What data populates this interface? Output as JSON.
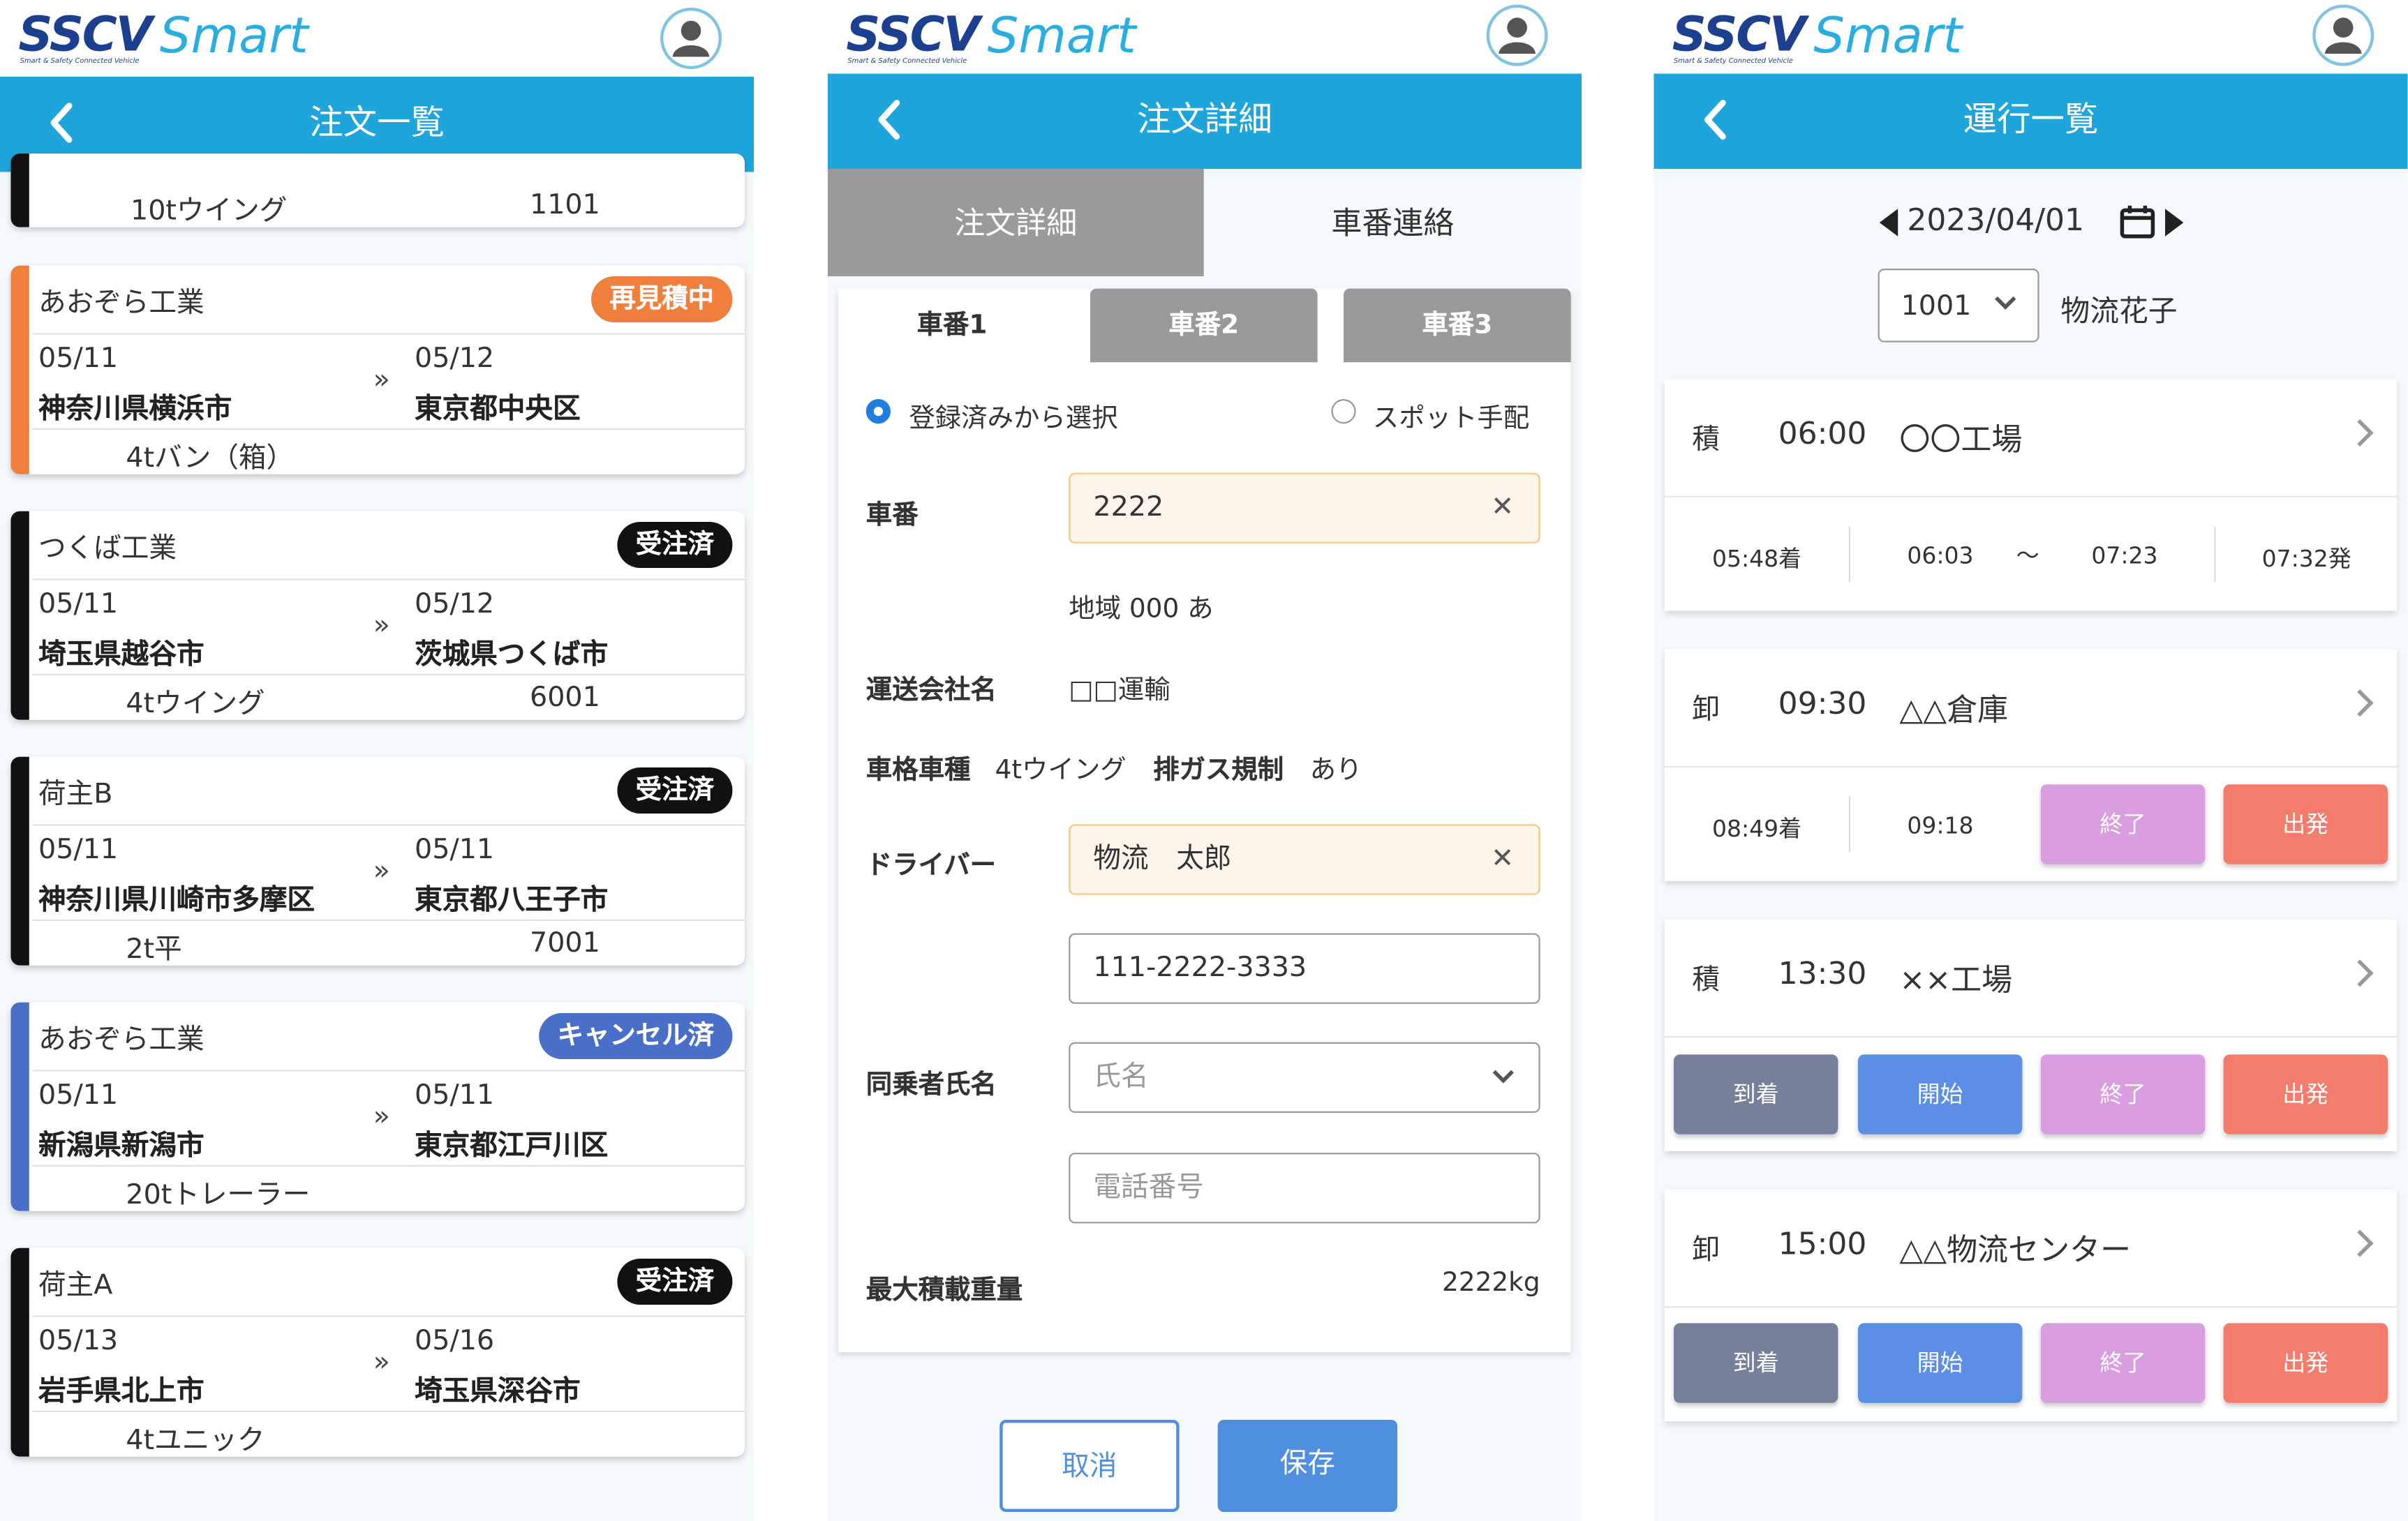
{
  "brand": {
    "logo_main": "SSCV",
    "logo_sub": "Smart & Safety Connected Vehicle",
    "logo_smart": "Smart"
  },
  "panel1": {
    "title": "注文一覧",
    "partial": {
      "vehicle": "10tウイング",
      "code": "1101"
    },
    "orders": [
      {
        "company": "あおぞら工業",
        "status": "再見積中",
        "status_color": "#f07e3c",
        "stripe": "#f07e3c",
        "from_date": "05/11",
        "from_place": "神奈川県横浜市",
        "to_date": "05/12",
        "to_place": "東京都中央区",
        "vehicle": "4tバン（箱）",
        "code": ""
      },
      {
        "company": "つくば工業",
        "status": "受注済",
        "status_color": "#111111",
        "stripe": "#111111",
        "from_date": "05/11",
        "from_place": "埼玉県越谷市",
        "to_date": "05/12",
        "to_place": "茨城県つくば市",
        "vehicle": "4tウイング",
        "code": "6001"
      },
      {
        "company": "荷主B",
        "status": "受注済",
        "status_color": "#111111",
        "stripe": "#111111",
        "from_date": "05/11",
        "from_place": "神奈川県川崎市多摩区",
        "to_date": "05/11",
        "to_place": "東京都八王子市",
        "vehicle": "2t平",
        "code": "7001"
      },
      {
        "company": "あおぞら工業",
        "status": "キャンセル済",
        "status_color": "#4a6fc9",
        "stripe": "#4a6fc9",
        "from_date": "05/11",
        "from_place": "新潟県新潟市",
        "to_date": "05/11",
        "to_place": "東京都江戸川区",
        "vehicle": "20tトレーラー",
        "code": ""
      },
      {
        "company": "荷主A",
        "status": "受注済",
        "status_color": "#111111",
        "stripe": "#111111",
        "from_date": "05/13",
        "from_place": "岩手県北上市",
        "to_date": "05/16",
        "to_place": "埼玉県深谷市",
        "vehicle": "4tユニック",
        "code": ""
      }
    ]
  },
  "panel2": {
    "title": "注文詳細",
    "tab_detail": "注文詳細",
    "tab_contact": "車番連絡",
    "vehicle_tabs": [
      "車番1",
      "車番2",
      "車番3"
    ],
    "radio_registered": "登録済みから選択",
    "radio_spot": "スポット手配",
    "label_number": "車番",
    "number_value": "2222",
    "area": "地域 000 あ",
    "label_company": "運送会社名",
    "company_value": "□□運輸",
    "label_type": "車格車種",
    "type_value": "4tウイング",
    "label_emission": "排ガス規制",
    "emission_value": "あり",
    "label_driver": "ドライバー",
    "driver_value": "物流　太郎",
    "phone_value": "111-2222-3333",
    "label_passenger": "同乗者氏名",
    "passenger_placeholder": "氏名",
    "passenger_phone_placeholder": "電話番号",
    "label_max_load": "最大積載重量",
    "max_load_value": "2222kg",
    "cancel_label": "取消",
    "save_label": "保存"
  },
  "panel3": {
    "title": "運行一覧",
    "date": "2023/04/01",
    "vehicle_select": "1001",
    "driver_name": "物流花子",
    "events": [
      {
        "kind": "積",
        "time": "06:00",
        "place": "〇〇工場",
        "arrived": "05:48着",
        "start": "06:03",
        "tilde": "〜",
        "end": "07:23",
        "depart": "07:32発"
      },
      {
        "kind": "卸",
        "time": "09:30",
        "place": "△△倉庫",
        "arrived": "08:49着",
        "start": "09:18"
      },
      {
        "kind": "積",
        "time": "13:30",
        "place": "××工場"
      },
      {
        "kind": "卸",
        "time": "15:00",
        "place": "△△物流センター"
      }
    ],
    "btn_arrive": "到着",
    "btn_start": "開始",
    "btn_end": "終了",
    "btn_depart": "出発",
    "colors": {
      "arrive": "#76809a",
      "start": "#5b8fe6",
      "end": "#d99ee0",
      "depart": "#f47c6c"
    }
  }
}
